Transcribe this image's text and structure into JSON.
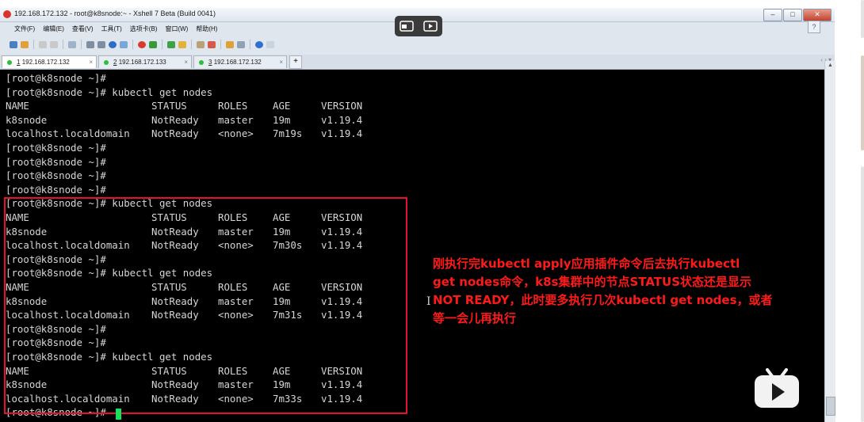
{
  "window": {
    "title": "192.168.172.132 - root@k8snode:~ - Xshell 7 Beta (Build 0041)",
    "help_label": "?",
    "buttons": {
      "minimize": "–",
      "maximize": "□",
      "close": "✕"
    }
  },
  "menu": [
    "文件(F)",
    "编辑(E)",
    "查看(V)",
    "工具(T)",
    "选项卡(B)",
    "窗口(W)",
    "帮助(H)"
  ],
  "tabs": [
    {
      "num": "1",
      "label": "192.168.172.132",
      "close": "×"
    },
    {
      "num": "2",
      "label": "192.168.172.133",
      "close": "×"
    },
    {
      "num": "3",
      "label": "192.168.172.132",
      "close": "×"
    }
  ],
  "tab_add": "+",
  "tab_nav": "‹ ›  ▾",
  "terminal": {
    "header": [
      "NAME",
      "STATUS",
      "ROLES",
      "AGE",
      "VERSION"
    ],
    "prompt": "[root@k8snode ~]#",
    "command": "[root@k8snode ~]# kubectl get nodes",
    "blocks": [
      {
        "rows": [
          [
            "k8snode",
            "NotReady",
            "master",
            "19m",
            "v1.19.4"
          ],
          [
            "localhost.localdomain",
            "NotReady",
            "<none>",
            "7m19s",
            "v1.19.4"
          ]
        ]
      },
      {
        "rows": [
          [
            "k8snode",
            "NotReady",
            "master",
            "19m",
            "v1.19.4"
          ],
          [
            "localhost.localdomain",
            "NotReady",
            "<none>",
            "7m30s",
            "v1.19.4"
          ]
        ]
      },
      {
        "rows": [
          [
            "k8snode",
            "NotReady",
            "master",
            "19m",
            "v1.19.4"
          ],
          [
            "localhost.localdomain",
            "NotReady",
            "<none>",
            "7m31s",
            "v1.19.4"
          ]
        ]
      },
      {
        "rows": [
          [
            "k8snode",
            "NotReady",
            "master",
            "19m",
            "v1.19.4"
          ],
          [
            "localhost.localdomain",
            "NotReady",
            "<none>",
            "7m33s",
            "v1.19.4"
          ]
        ]
      }
    ]
  },
  "annotation": [
    "刚执行完kubectl apply应用插件命令后去执行kubectl",
    "get nodes命令，k8s集群中的节点STATUS状态还是显示",
    "NOT READY，此时要多执行几次kubectl get nodes，或者",
    "等一会儿再执行"
  ],
  "colors": {
    "terminal_bg": "#000000",
    "terminal_text": "#d6d6d6",
    "highlight_box": "#e8112d",
    "annotation": "#ff1a1a",
    "cursor": "#19e05a"
  }
}
